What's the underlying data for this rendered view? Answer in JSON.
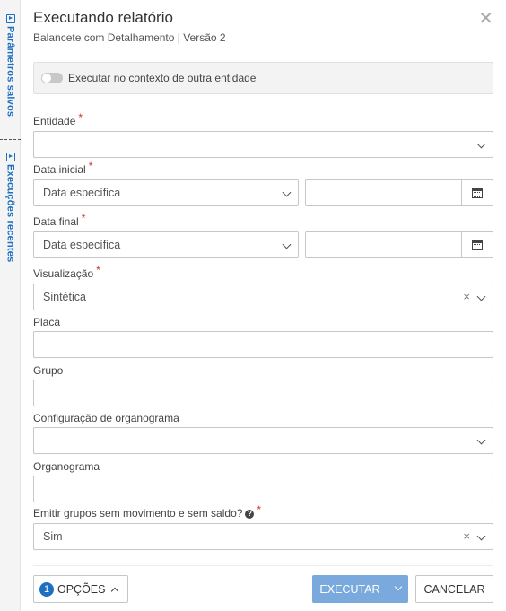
{
  "side_tabs": {
    "saved_params": "Parâmetros salvos",
    "recent_runs": "Execuções recentes"
  },
  "dialog": {
    "title": "Executando relatório",
    "subtitle": "Balancete com Detalhamento | Versão 2",
    "context_toggle_label": "Executar no contexto de outra entidade",
    "context_toggle_on": false
  },
  "form": {
    "entidade": {
      "label": "Entidade",
      "required": "*",
      "value": ""
    },
    "data_inicial": {
      "label": "Data inicial",
      "required": "*",
      "mode": "Data específica",
      "value": ""
    },
    "data_final": {
      "label": "Data final",
      "required": "*",
      "mode": "Data específica",
      "value": ""
    },
    "visualizacao": {
      "label": "Visualização",
      "required": "*",
      "value": "Sintética"
    },
    "placa": {
      "label": "Placa",
      "value": ""
    },
    "grupo": {
      "label": "Grupo",
      "value": ""
    },
    "config_organograma": {
      "label": "Configuração de organograma",
      "value": ""
    },
    "organograma": {
      "label": "Organograma",
      "value": ""
    },
    "emitir_grupos": {
      "label": "Emitir grupos sem movimento e sem saldo?",
      "required": "*",
      "value": "Sim"
    }
  },
  "footer": {
    "options_count": "1",
    "options_label": "OPÇÕES",
    "execute_label": "EXECUTAR",
    "cancel_label": "CANCELAR"
  },
  "colors": {
    "accent": "#1e6fc2",
    "execute_button": "#7aa9dd",
    "required_marker": "#d32f2f"
  }
}
